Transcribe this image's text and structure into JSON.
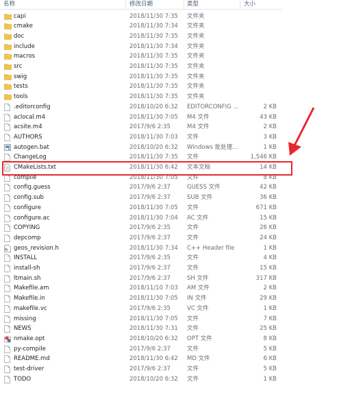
{
  "columns": {
    "name": "名称",
    "date": "修改日期",
    "type": "类型",
    "size": "大小"
  },
  "files": [
    {
      "name": "capi",
      "date": "2018/11/30 7:35",
      "type": "文件夹",
      "size": "",
      "icon": "folder-icon"
    },
    {
      "name": "cmake",
      "date": "2018/11/30 7:34",
      "type": "文件夹",
      "size": "",
      "icon": "folder-icon"
    },
    {
      "name": "doc",
      "date": "2018/11/30 7:35",
      "type": "文件夹",
      "size": "",
      "icon": "folder-icon"
    },
    {
      "name": "include",
      "date": "2018/11/30 7:34",
      "type": "文件夹",
      "size": "",
      "icon": "folder-icon"
    },
    {
      "name": "macros",
      "date": "2018/11/30 7:35",
      "type": "文件夹",
      "size": "",
      "icon": "folder-icon"
    },
    {
      "name": "src",
      "date": "2018/11/30 7:35",
      "type": "文件夹",
      "size": "",
      "icon": "folder-icon"
    },
    {
      "name": "swig",
      "date": "2018/11/30 7:35",
      "type": "文件夹",
      "size": "",
      "icon": "folder-icon"
    },
    {
      "name": "tests",
      "date": "2018/11/30 7:35",
      "type": "文件夹",
      "size": "",
      "icon": "folder-icon"
    },
    {
      "name": "tools",
      "date": "2018/11/30 7:35",
      "type": "文件夹",
      "size": "",
      "icon": "folder-icon"
    },
    {
      "name": ".editorconfig",
      "date": "2018/10/20 6:32",
      "type": "EDITORCONFIG ...",
      "size": "2 KB",
      "icon": "file-icon"
    },
    {
      "name": "aclocal.m4",
      "date": "2018/11/30 7:05",
      "type": "M4 文件",
      "size": "43 KB",
      "icon": "file-icon"
    },
    {
      "name": "acsite.m4",
      "date": "2017/9/6 2:35",
      "type": "M4 文件",
      "size": "2 KB",
      "icon": "file-icon"
    },
    {
      "name": "AUTHORS",
      "date": "2018/11/30 7:03",
      "type": "文件",
      "size": "3 KB",
      "icon": "file-icon"
    },
    {
      "name": "autogen.bat",
      "date": "2018/10/20 6:32",
      "type": "Windows 批处理...",
      "size": "1 KB",
      "icon": "batch-file-icon"
    },
    {
      "name": "ChangeLog",
      "date": "2018/11/30 7:35",
      "type": "文件",
      "size": "1,546 KB",
      "icon": "file-icon"
    },
    {
      "name": "CMakeLists.txt",
      "date": "2018/11/30 6:42",
      "type": "文本文档",
      "size": "14 KB",
      "icon": "text-file-icon"
    },
    {
      "name": "compile",
      "date": "2018/11/30 7:05",
      "type": "文件",
      "size": "8 KB",
      "icon": "file-icon"
    },
    {
      "name": "config.guess",
      "date": "2017/9/6 2:37",
      "type": "GUESS 文件",
      "size": "42 KB",
      "icon": "file-icon"
    },
    {
      "name": "config.sub",
      "date": "2017/9/6 2:37",
      "type": "SUB 文件",
      "size": "36 KB",
      "icon": "file-icon"
    },
    {
      "name": "configure",
      "date": "2018/11/30 7:05",
      "type": "文件",
      "size": "671 KB",
      "icon": "file-icon"
    },
    {
      "name": "configure.ac",
      "date": "2018/11/30 7:04",
      "type": "AC 文件",
      "size": "15 KB",
      "icon": "file-icon"
    },
    {
      "name": "COPYING",
      "date": "2017/9/6 2:35",
      "type": "文件",
      "size": "26 KB",
      "icon": "file-icon"
    },
    {
      "name": "depcomp",
      "date": "2017/9/6 2:37",
      "type": "文件",
      "size": "24 KB",
      "icon": "file-icon"
    },
    {
      "name": "geos_revision.h",
      "date": "2018/11/30 7:34",
      "type": "C++ Header file",
      "size": "1 KB",
      "icon": "header-file-icon"
    },
    {
      "name": "INSTALL",
      "date": "2017/9/6 2:35",
      "type": "文件",
      "size": "4 KB",
      "icon": "file-icon"
    },
    {
      "name": "install-sh",
      "date": "2017/9/6 2:37",
      "type": "文件",
      "size": "15 KB",
      "icon": "file-icon"
    },
    {
      "name": "ltmain.sh",
      "date": "2017/9/6 2:37",
      "type": "SH 文件",
      "size": "317 KB",
      "icon": "file-icon"
    },
    {
      "name": "Makefile.am",
      "date": "2018/11/10 7:03",
      "type": "AM 文件",
      "size": "2 KB",
      "icon": "file-icon"
    },
    {
      "name": "Makefile.in",
      "date": "2018/11/30 7:05",
      "type": "IN 文件",
      "size": "29 KB",
      "icon": "file-icon"
    },
    {
      "name": "makefile.vc",
      "date": "2017/9/6 2:35",
      "type": "VC 文件",
      "size": "1 KB",
      "icon": "file-icon"
    },
    {
      "name": "missing",
      "date": "2018/11/30 7:05",
      "type": "文件",
      "size": "7 KB",
      "icon": "file-icon"
    },
    {
      "name": "NEWS",
      "date": "2018/11/30 7:31",
      "type": "文件",
      "size": "25 KB",
      "icon": "file-icon"
    },
    {
      "name": "nmake.opt",
      "date": "2018/10/20 6:32",
      "type": "OPT 文件",
      "size": "8 KB",
      "icon": "opt-file-icon"
    },
    {
      "name": "py-compile",
      "date": "2017/9/6 2:37",
      "type": "文件",
      "size": "5 KB",
      "icon": "file-icon"
    },
    {
      "name": "README.md",
      "date": "2018/11/30 6:42",
      "type": "MD 文件",
      "size": "6 KB",
      "icon": "file-icon"
    },
    {
      "name": "test-driver",
      "date": "2017/9/6 2:37",
      "type": "文件",
      "size": "5 KB",
      "icon": "file-icon"
    },
    {
      "name": "TODO",
      "date": "2018/10/20 6:32",
      "type": "文件",
      "size": "1 KB",
      "icon": "file-icon"
    }
  ],
  "colors": {
    "folder": "#f0c44c",
    "highlight": "#e8272e",
    "header_text": "#4c607a"
  }
}
